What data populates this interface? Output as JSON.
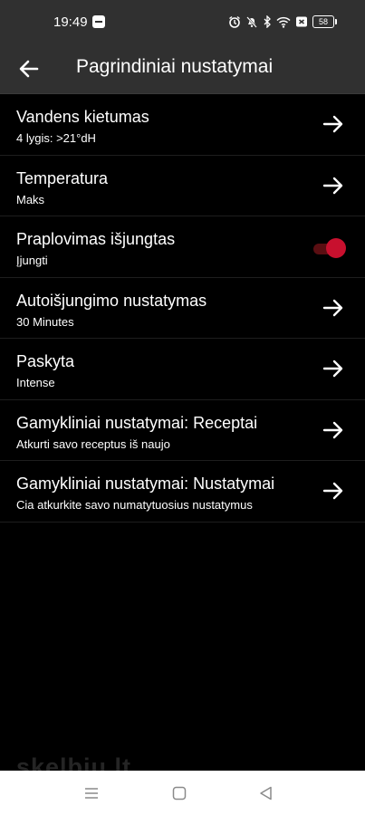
{
  "status_bar": {
    "time": "19:49",
    "battery": "58"
  },
  "app_bar": {
    "title": "Pagrindiniai nustatymai"
  },
  "settings": [
    {
      "title": "Vandens kietumas",
      "subtitle": "4 lygis: >21°dH",
      "control": "arrow-right-icon"
    },
    {
      "title": "Temperatura",
      "subtitle": "Maks",
      "control": "arrow-right-icon"
    },
    {
      "title": "Praplovimas išjungtas",
      "subtitle": "Įjungti",
      "control": "toggle",
      "toggle_on": true
    },
    {
      "title": "Autoišjungimo nustatymas",
      "subtitle": "30 Minutes",
      "control": "arrow-right-icon"
    },
    {
      "title": "Paskyta",
      "subtitle": "Intense",
      "control": "arrow-right-icon"
    },
    {
      "title": "Gamykliniai nustatymai: Receptai",
      "subtitle": "Atkurti savo receptus iš naujo",
      "control": "arrow-right-icon"
    },
    {
      "title": "Gamykliniai nustatymai: Nustatymai",
      "subtitle": "Cia atkurkite savo numatytuosius nustatymus",
      "control": "arrow-right-icon"
    }
  ],
  "watermark": "skelbiu.lt",
  "colors": {
    "bar": "#303030",
    "background": "#000000",
    "accent": "#c8102e"
  },
  "nav_bar": [
    "menu-icon",
    "home-square-icon",
    "back-triangle-icon"
  ]
}
